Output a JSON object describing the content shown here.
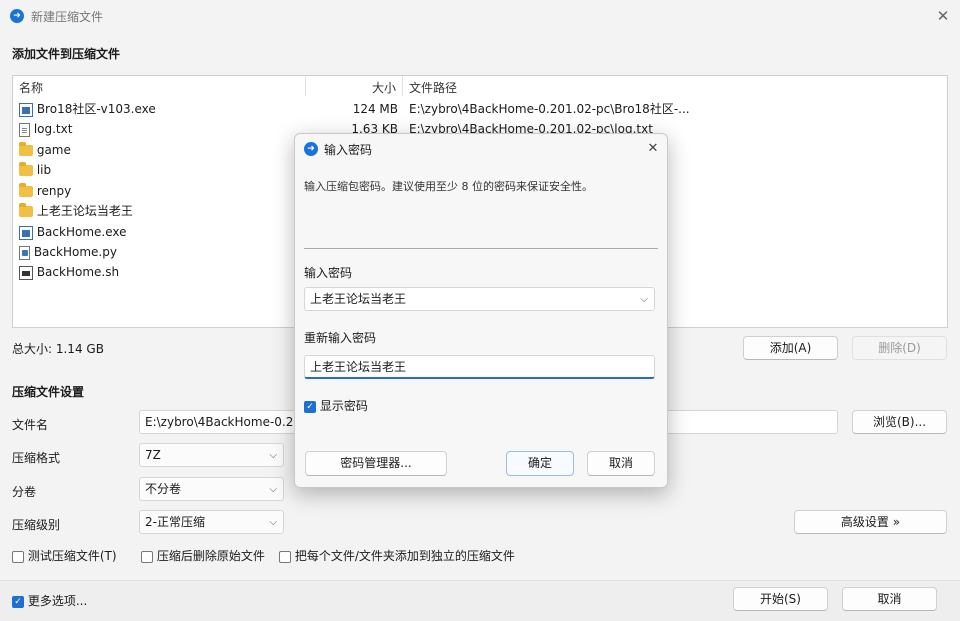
{
  "window": {
    "icon_glyph": "➜",
    "title": "新建压缩文件",
    "close_glyph": "✕"
  },
  "files_section": {
    "heading": "添加文件到压缩文件",
    "columns": {
      "name": "名称",
      "size": "大小",
      "path": "文件路径"
    },
    "rows": [
      {
        "icon": "exe-icon",
        "name": "Bro18社区-v103.exe",
        "size": "124 MB",
        "path": "E:\\zybro\\4BackHome-0.201.02-pc\\Bro18社区-..."
      },
      {
        "icon": "text-file-icon",
        "name": "log.txt",
        "size": "1.63 KB",
        "path": "E:\\zybro\\4BackHome-0.201.02-pc\\log.txt"
      },
      {
        "icon": "folder-icon",
        "name": "game",
        "size": "",
        "path": ""
      },
      {
        "icon": "folder-icon",
        "name": "lib",
        "size": "",
        "path": ""
      },
      {
        "icon": "folder-icon",
        "name": "renpy",
        "size": "",
        "path": ""
      },
      {
        "icon": "folder-icon",
        "name": "上老王论坛当老王",
        "size": "",
        "path": ""
      },
      {
        "icon": "exe-icon",
        "name": "BackHome.exe",
        "size": "",
        "path": ""
      },
      {
        "icon": "python-file-icon",
        "name": "BackHome.py",
        "size": "",
        "path": ""
      },
      {
        "icon": "shell-file-icon",
        "name": "BackHome.sh",
        "size": "",
        "path": ""
      }
    ],
    "total_size": "总大小: 1.14 GB",
    "add_button": "添加(A)",
    "delete_button": "删除(D)"
  },
  "settings": {
    "heading": "压缩文件设置",
    "filename_label": "文件名",
    "filename_value": "E:\\zybro\\4BackHome-0.20",
    "browse_button": "浏览(B)...",
    "format_label": "压缩格式",
    "format_value": "7Z",
    "split_label": "分卷",
    "split_value": "不分卷",
    "level_label": "压缩级别",
    "level_value": "2-正常压缩",
    "advanced_button": "高级设置 »",
    "check_test": "测试压缩文件(T)",
    "check_delete": "压缩后删除原始文件",
    "check_each": "把每个文件/文件夹添加到独立的压缩文件",
    "more_options": "更多选项...",
    "start_button": "开始(S)",
    "cancel_button": "取消"
  },
  "dialog": {
    "icon_glyph": "➜",
    "title": "输入密码",
    "close_glyph": "✕",
    "message": "输入压缩包密码。建议使用至少 8 位的密码来保证安全性。",
    "password_label": "输入密码",
    "password_value": "上老王论坛当老王",
    "reenter_label": "重新输入密码",
    "reenter_value": "上老王论坛当老王",
    "show_password": "显示密码",
    "manager_button": "密码管理器...",
    "ok_button": "确定",
    "cancel_button": "取消"
  }
}
